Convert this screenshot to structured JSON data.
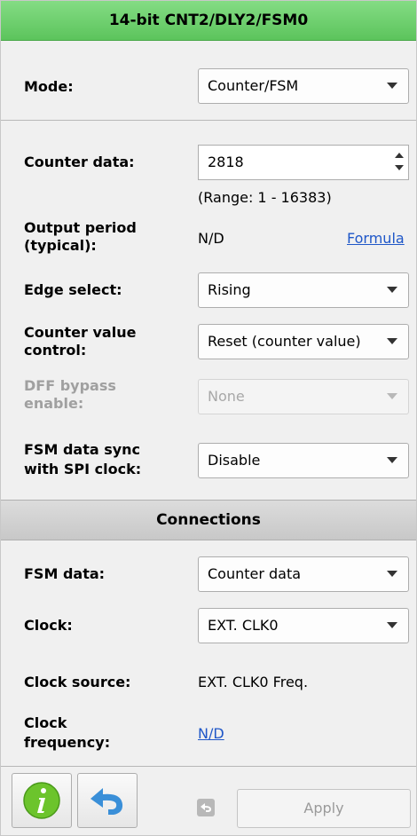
{
  "window": {
    "title": "14-bit CNT2/DLY2/FSM0"
  },
  "properties": {
    "mode": {
      "label": "Mode:",
      "value": "Counter/FSM"
    },
    "counter_data": {
      "label": "Counter data:",
      "value": "2818",
      "range_text": "(Range:  1 - 16383)"
    },
    "output_period": {
      "label_line1": "Output period",
      "label_line2": "(typical):",
      "value": "N/D",
      "link": "Formula"
    },
    "edge_select": {
      "label": "Edge select:",
      "value": "Rising"
    },
    "counter_value_control": {
      "label_line1": "Counter value",
      "label_line2": "control:",
      "value": "Reset (counter value)"
    },
    "dff_bypass": {
      "label_line1": "DFF bypass",
      "label_line2": "enable:",
      "value": "None"
    },
    "fsm_sync": {
      "label_line1": "FSM data sync",
      "label_line2": "with SPI clock:",
      "value": "Disable"
    }
  },
  "connections": {
    "header": "Connections",
    "fsm_data": {
      "label": "FSM data:",
      "value": "Counter data"
    },
    "clock": {
      "label": "Clock:",
      "value": "EXT. CLK0"
    },
    "clock_source": {
      "label": "Clock source:",
      "value": "EXT. CLK0 Freq."
    },
    "clock_frequency": {
      "label_line1": "Clock",
      "label_line2": "frequency:",
      "value": "N/D"
    }
  },
  "footer": {
    "apply_label": "Apply"
  },
  "colors": {
    "title_bar": "#5cc45c",
    "link": "#1f57c8",
    "info_icon": "#6cc42c",
    "undo_icon": "#3a8fd8"
  }
}
